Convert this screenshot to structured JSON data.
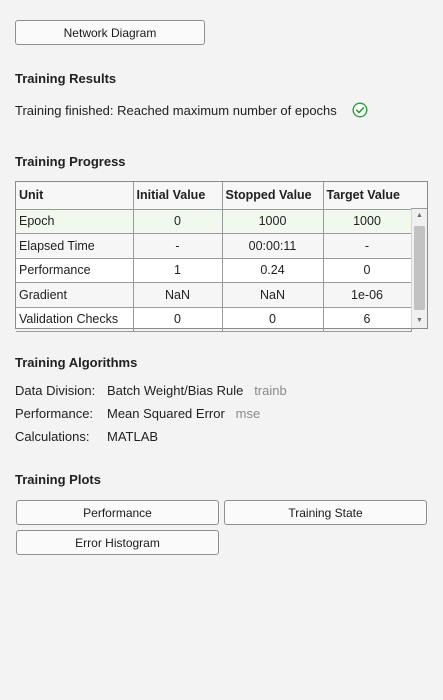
{
  "buttons": {
    "network_diagram": "Network Diagram"
  },
  "results": {
    "heading": "Training Results",
    "status": "Training finished: Reached maximum number of epochs",
    "status_icon": "check-circle-icon",
    "status_color": "#2e9e3a"
  },
  "progress": {
    "heading": "Training Progress",
    "columns": [
      "Unit",
      "Initial Value",
      "Stopped Value",
      "Target Value"
    ],
    "rows": [
      [
        "Epoch",
        "0",
        "1000",
        "1000"
      ],
      [
        "Elapsed Time",
        "-",
        "00:00:11",
        "-"
      ],
      [
        "Performance",
        "1",
        "0.24",
        "0"
      ],
      [
        "Gradient",
        "NaN",
        "NaN",
        "1e-06"
      ],
      [
        "Validation Checks",
        "0",
        "0",
        "6"
      ]
    ],
    "selected_row_color": "#f1f8ee"
  },
  "algorithms": {
    "heading": "Training Algorithms",
    "items": [
      {
        "label": "Data Division:",
        "value": "Batch Weight/Bias Rule",
        "code": "trainb"
      },
      {
        "label": "Performance:",
        "value": "Mean Squared Error",
        "code": "mse"
      },
      {
        "label": "Calculations:",
        "value": "MATLAB",
        "code": ""
      }
    ]
  },
  "plots": {
    "heading": "Training Plots",
    "performance": "Performance",
    "training_state": "Training State",
    "error_histogram": "Error Histogram"
  }
}
